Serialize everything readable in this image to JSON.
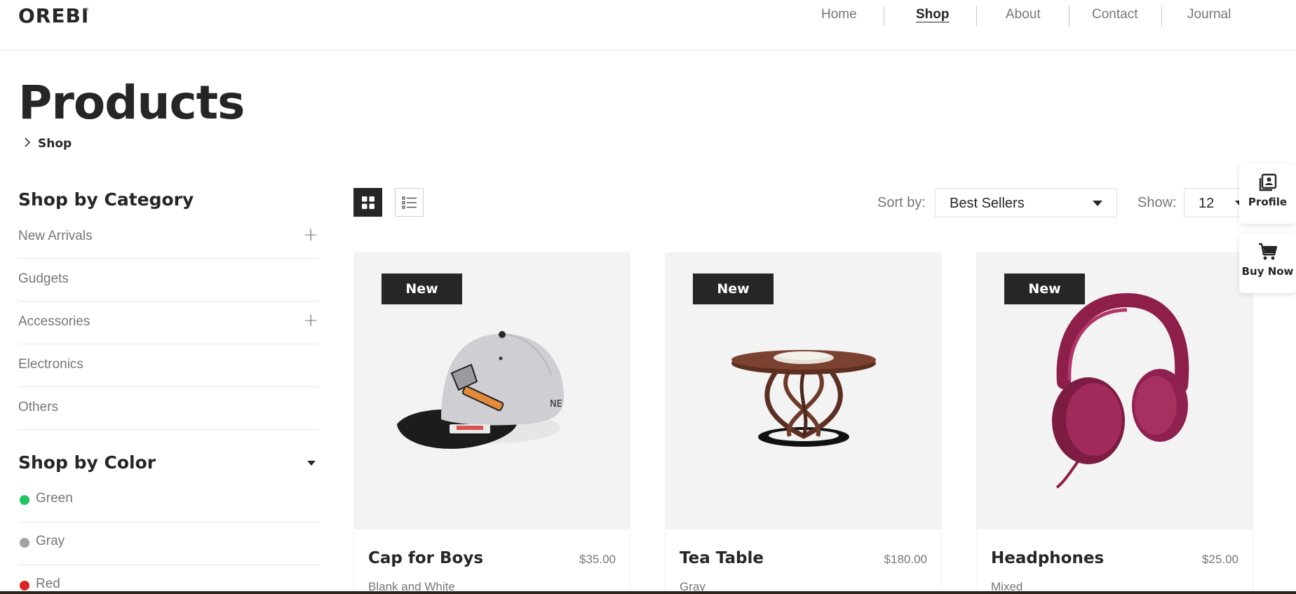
{
  "header": {
    "logo": "OREBI",
    "nav": [
      {
        "label": "Home",
        "active": false
      },
      {
        "label": "Shop",
        "active": true
      },
      {
        "label": "About",
        "active": false
      },
      {
        "label": "Contact",
        "active": false
      },
      {
        "label": "Journal",
        "active": false
      }
    ]
  },
  "page": {
    "title": "Products",
    "breadcrumb": "Shop"
  },
  "sidebar": {
    "category_heading": "Shop by Category",
    "categories": [
      {
        "label": "New Arrivals",
        "expandable": true
      },
      {
        "label": "Gudgets",
        "expandable": false
      },
      {
        "label": "Accessories",
        "expandable": true
      },
      {
        "label": "Electronics",
        "expandable": false
      },
      {
        "label": "Others",
        "expandable": false
      }
    ],
    "color_heading": "Shop by Color",
    "colors": [
      {
        "label": "Green",
        "swatch": "#22c55e"
      },
      {
        "label": "Gray",
        "swatch": "#a3a3a3"
      },
      {
        "label": "Red",
        "swatch": "#dc2626"
      }
    ]
  },
  "toolbar": {
    "sort_label": "Sort by:",
    "sort_value": "Best Sellers",
    "show_label": "Show:",
    "show_value": "12"
  },
  "floating": {
    "profile_label": "Profile",
    "buy_label": "Buy Now"
  },
  "products": [
    {
      "badge": "New",
      "name": "Cap for Boys",
      "price": "$35.00",
      "color": "Blank and White",
      "image": "cap-image"
    },
    {
      "badge": "New",
      "name": "Tea Table",
      "price": "$180.00",
      "color": "Gray",
      "image": "table-image"
    },
    {
      "badge": "New",
      "name": "Headphones",
      "price": "$25.00",
      "color": "Mixed",
      "image": "headphones-image"
    }
  ],
  "colors": {
    "dark": "#262626",
    "muted": "#767676",
    "card_bg": "#f3f3f3"
  }
}
